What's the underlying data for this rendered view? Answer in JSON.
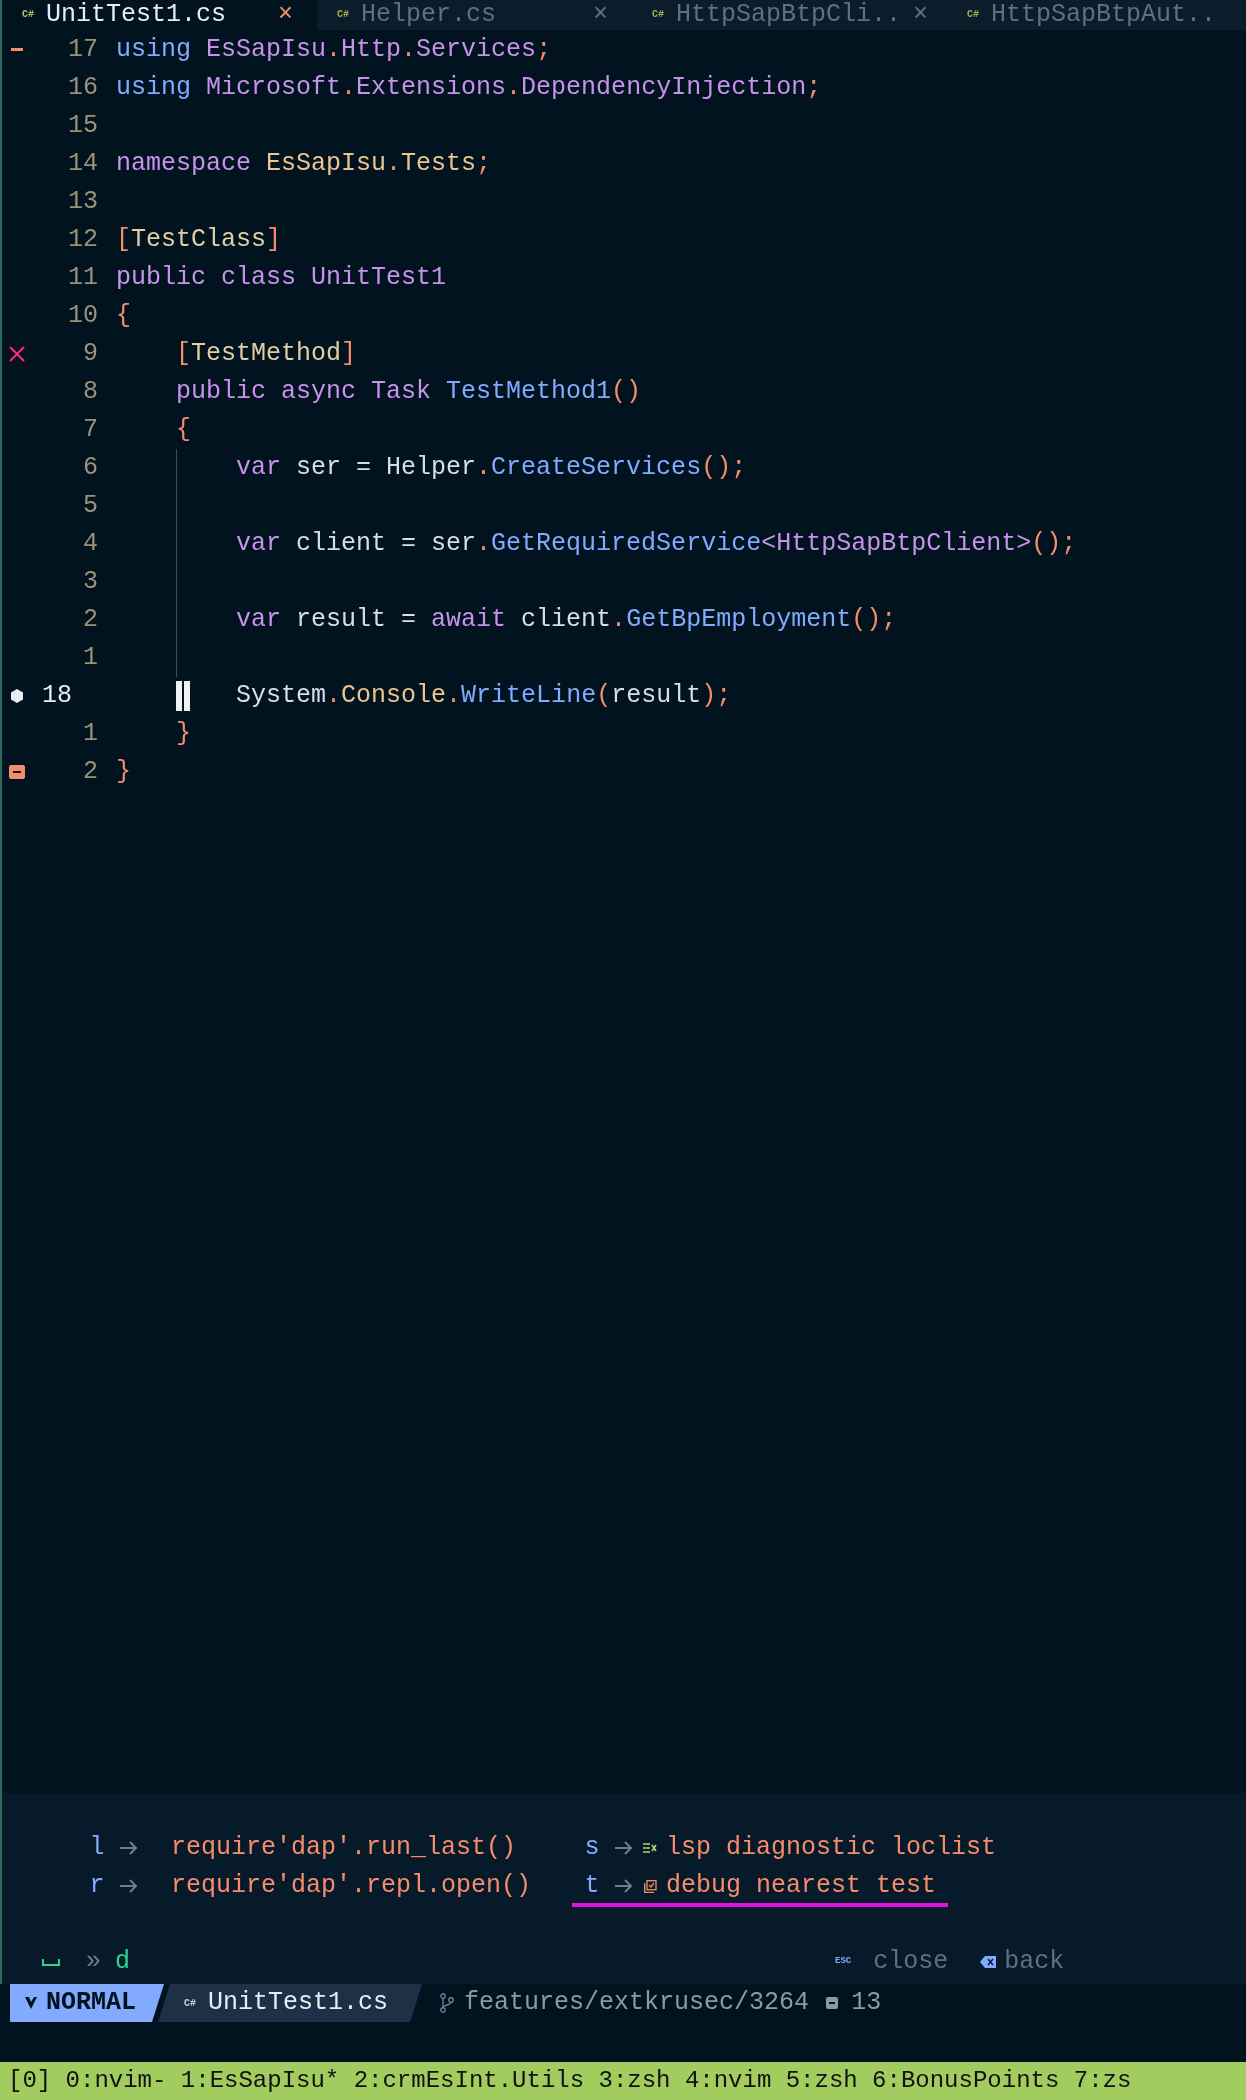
{
  "tabs": [
    {
      "icon_text": "C#",
      "label": "UnitTest1.cs",
      "close": "×",
      "selected": true
    },
    {
      "icon_text": "C#",
      "label": "Helper.cs",
      "close": "×",
      "selected": false
    },
    {
      "icon_text": "C#",
      "label": "HttpSapBtpCli..",
      "close": "×",
      "selected": false
    },
    {
      "icon_text": "C#",
      "label": "HttpSapBtpAut..",
      "selected": false
    }
  ],
  "editor": {
    "lines": [
      {
        "number": "17",
        "current": false,
        "sign": {
          "kind": "removed"
        },
        "guide": false,
        "cursor": false,
        "tokens": [
          {
            "kind": "import",
            "text": "using"
          },
          {
            "kind": "ns",
            "text": " EsSapIsu"
          },
          {
            "kind": "punct",
            "text": "."
          },
          {
            "kind": "ns",
            "text": "Http"
          },
          {
            "kind": "punct",
            "text": "."
          },
          {
            "kind": "ns",
            "text": "Services"
          },
          {
            "kind": "punct",
            "text": ";"
          }
        ]
      },
      {
        "number": "16",
        "current": false,
        "guide": false,
        "cursor": false,
        "tokens": [
          {
            "kind": "import",
            "text": "using"
          },
          {
            "kind": "ns",
            "text": " Microsoft"
          },
          {
            "kind": "punct",
            "text": "."
          },
          {
            "kind": "ns",
            "text": "Extensions"
          },
          {
            "kind": "punct",
            "text": "."
          },
          {
            "kind": "ns",
            "text": "DependencyInjection"
          },
          {
            "kind": "punct",
            "text": ";"
          }
        ]
      },
      {
        "number": "15",
        "current": false,
        "guide": false,
        "cursor": false
      },
      {
        "number": "14",
        "current": false,
        "guide": false,
        "cursor": false,
        "tokens": [
          {
            "kind": "keyword",
            "text": "namespace"
          },
          {
            "kind": "class",
            "text": " EsSapIsu"
          },
          {
            "kind": "punct",
            "text": "."
          },
          {
            "kind": "class",
            "text": "Tests"
          },
          {
            "kind": "punct",
            "text": ";"
          }
        ]
      },
      {
        "number": "13",
        "current": false,
        "guide": false,
        "cursor": false
      },
      {
        "number": "12",
        "current": false,
        "guide": false,
        "cursor": false,
        "tokens": [
          {
            "kind": "punct",
            "text": "["
          },
          {
            "kind": "attr",
            "text": "TestClass"
          },
          {
            "kind": "punct",
            "text": "]"
          }
        ]
      },
      {
        "number": "11",
        "current": false,
        "guide": false,
        "cursor": false,
        "tokens": [
          {
            "kind": "keyword",
            "text": "public class UnitTest1"
          }
        ]
      },
      {
        "number": "10",
        "current": false,
        "guide": false,
        "cursor": false,
        "tokens": [
          {
            "kind": "punct",
            "text": "{"
          }
        ]
      },
      {
        "number": "9",
        "current": false,
        "sign": {
          "kind": "error"
        },
        "guide": false,
        "cursor": false,
        "tokens": [
          {
            "kind": "punct",
            "text": "    ["
          },
          {
            "kind": "attr",
            "text": "TestMethod"
          },
          {
            "kind": "punct",
            "text": "]"
          }
        ]
      },
      {
        "number": "8",
        "current": false,
        "guide": false,
        "cursor": false,
        "tokens": [
          {
            "kind": "keyword",
            "text": "    public async Task"
          },
          {
            "kind": "method",
            "text": " TestMethod1"
          },
          {
            "kind": "punct",
            "text": "()"
          }
        ]
      },
      {
        "number": "7",
        "current": false,
        "guide": false,
        "cursor": false,
        "tokens": [
          {
            "kind": "punct",
            "text": "    {"
          }
        ]
      },
      {
        "number": "6",
        "current": false,
        "guide": true,
        "cursor": false,
        "tokens": [
          {
            "kind": "keyword",
            "text": "        var"
          },
          {
            "kind": "plain",
            "text": " ser = Helper"
          },
          {
            "kind": "punct",
            "text": "."
          },
          {
            "kind": "method",
            "text": "CreateServices"
          },
          {
            "kind": "punct",
            "text": "();"
          }
        ]
      },
      {
        "number": "5",
        "current": false,
        "guide": true,
        "cursor": false
      },
      {
        "number": "4",
        "current": false,
        "guide": true,
        "cursor": false,
        "tokens": [
          {
            "kind": "keyword",
            "text": "        var"
          },
          {
            "kind": "plain",
            "text": " client = ser"
          },
          {
            "kind": "punct",
            "text": "."
          },
          {
            "kind": "method",
            "text": "GetRequiredService"
          },
          {
            "kind": "generic",
            "text": "<HttpSapBtpClient>"
          },
          {
            "kind": "punct",
            "text": "();"
          }
        ]
      },
      {
        "number": "3",
        "current": false,
        "guide": true,
        "cursor": false
      },
      {
        "number": "2",
        "current": false,
        "guide": true,
        "cursor": false,
        "tokens": [
          {
            "kind": "keyword",
            "text": "        var"
          },
          {
            "kind": "plain",
            "text": " result = "
          },
          {
            "kind": "keyword",
            "text": "await"
          },
          {
            "kind": "plain",
            "text": " client"
          },
          {
            "kind": "punct",
            "text": "."
          },
          {
            "kind": "method",
            "text": "GetBpEmployment"
          },
          {
            "kind": "punct",
            "text": "();"
          }
        ]
      },
      {
        "number": "1",
        "current": false,
        "guide": true,
        "cursor": false
      },
      {
        "number": "18",
        "current": true,
        "sign": {
          "kind": "breakpoint"
        },
        "guide": false,
        "cursor": true,
        "tokens": [
          {
            "kind": "plain",
            "text": "        System"
          },
          {
            "kind": "punct",
            "text": "."
          },
          {
            "kind": "class",
            "text": "Console"
          },
          {
            "kind": "punct",
            "text": "."
          },
          {
            "kind": "method",
            "text": "WriteLine"
          },
          {
            "kind": "punct",
            "text": "("
          },
          {
            "kind": "plain",
            "text": "result"
          },
          {
            "kind": "punct",
            "text": ");"
          }
        ]
      },
      {
        "number": "1",
        "current": false,
        "guide": false,
        "cursor": false,
        "tokens": [
          {
            "kind": "punct",
            "text": "    }"
          }
        ]
      },
      {
        "number": "2",
        "current": false,
        "sign": {
          "kind": "fold"
        },
        "guide": false,
        "cursor": false,
        "tokens": [
          {
            "kind": "punct",
            "text": "}"
          }
        ]
      }
    ]
  },
  "which_key": {
    "items": [
      {
        "kind": "plain",
        "key": "l",
        "description": "require'dap'.run_last()",
        "selected": false
      },
      {
        "kind": "diagnostic",
        "key": "s",
        "description": "lsp diagnostic loclist",
        "selected": false
      },
      {
        "kind": "plain",
        "key": "r",
        "description": "require'dap'.repl.open()",
        "selected": false
      },
      {
        "kind": "test",
        "key": "t",
        "description": "debug nearest test",
        "selected": true
      }
    ],
    "prefix": "»",
    "keys": "d",
    "esc_text": "ESC",
    "close_label": "close",
    "back_label": "back"
  },
  "status_line": {
    "mode": "NORMAL",
    "file_icon_text": "C#",
    "file": "UnitTest1.cs",
    "branch": "features/extkrusec/3264",
    "count": "13"
  },
  "tmux": {
    "session": "[0]",
    "windows": [
      "0:nvim-",
      "1:EsSapIsu*",
      "2:crmEsInt.Utils",
      "3:zsh",
      "4:nvim",
      "5:zsh",
      "6:BonusPoints",
      "7:zs"
    ]
  }
}
